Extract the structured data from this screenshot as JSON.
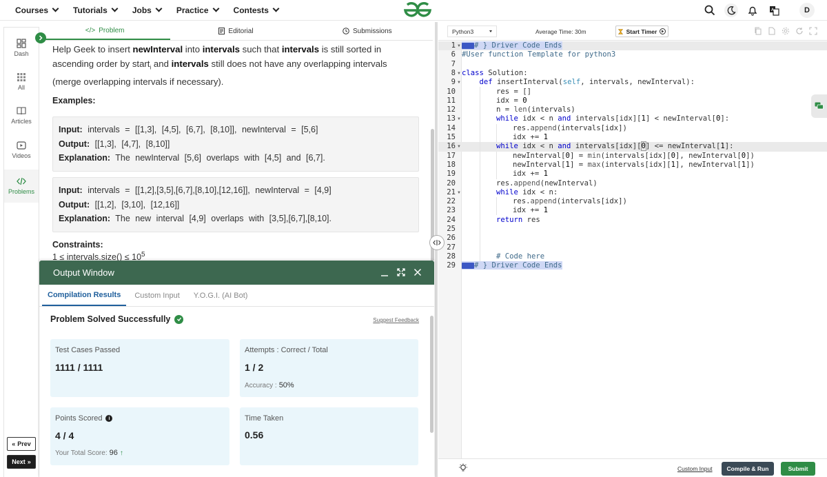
{
  "nav": {
    "items": [
      {
        "label": "Courses"
      },
      {
        "label": "Tutorials"
      },
      {
        "label": "Jobs"
      },
      {
        "label": "Practice"
      },
      {
        "label": "Contests"
      }
    ],
    "avatar": "D",
    "brand_color": "#2f8d46"
  },
  "rail": {
    "items": [
      {
        "label": "Dash",
        "icon": "dashboard-icon"
      },
      {
        "label": "All",
        "icon": "grid-icon"
      },
      {
        "label": "Articles",
        "icon": "book-icon"
      },
      {
        "label": "Videos",
        "icon": "video-icon"
      },
      {
        "label": "Problems",
        "icon": "code-icon"
      }
    ],
    "prev": "Prev",
    "next": "Next"
  },
  "problem_tabs": [
    {
      "label": "Problem",
      "icon": "</>"
    },
    {
      "label": "Editorial",
      "icon": "editorial-icon"
    },
    {
      "label": "Submissions",
      "icon": "clock-icon"
    }
  ],
  "statement": {
    "p1": "Help Geek to insert ",
    "b1": "newInterval",
    "p2": " into ",
    "b2": "intervals",
    "p3": " such that ",
    "b3": "intervals",
    "p4": " is still sorted in ascending order by start",
    "sub": "i",
    "p5": " and ",
    "b4": "intervals",
    "p6": " still does not have any overlapping intervals (merge overlapping intervals if necessary)."
  },
  "examples_heading": "Examples:",
  "examples": [
    {
      "input_label": "Input:",
      "input": "intervals = [[1,3], [4,5], [6,7], [8,10]], newInterval = [5,6]",
      "output_label": "Output:",
      "output": "[[1,3], [4,7], [8,10]]",
      "explanation_label": "Explanation:",
      "explanation": "The newInterval [5,6] overlaps with [4,5] and [6,7]."
    },
    {
      "input_label": "Input:",
      "input": "intervals = [[1,2],[3,5],[6,7],[8,10],[12,16]], newInterval = [4,9]",
      "output_label": "Output:",
      "output": "[[1,2], [3,10], [12,16]]",
      "explanation_label": "Explanation:",
      "explanation": "The new interval [4,9] overlaps with [3,5],[6,7],[8,10]."
    }
  ],
  "constraints": {
    "heading": "Constraints:",
    "line": "1 ≤ intervals.size() ≤ 10",
    "sup": "5"
  },
  "output_window": {
    "title": "Output Window",
    "tabs": [
      {
        "label": "Compilation Results"
      },
      {
        "label": "Custom Input"
      },
      {
        "label": "Y.O.G.I. (AI Bot)"
      }
    ],
    "status": "Problem Solved Successfully",
    "suggest": "Suggest Feedback",
    "cards": {
      "tests_title": "Test Cases Passed",
      "tests_value": "1111 / 1111",
      "attempts_title": "Attempts : Correct / Total",
      "attempts_value": "1 / 2",
      "accuracy_label": "Accuracy :",
      "accuracy_value": "50%",
      "points_title": "Points Scored",
      "points_value": "4 / 4",
      "total_label": "Your Total Score:",
      "total_value": "96",
      "time_title": "Time Taken",
      "time_value": "0.56"
    }
  },
  "editor": {
    "language": "Python3",
    "avg_time": "Average Time: 30m",
    "timer": "Start Timer",
    "custom_input": "Custom Input",
    "compile_run": "Compile & Run",
    "submit": "Submit",
    "lines": [
      {
        "n": "1",
        "fold": true
      },
      {
        "n": "6",
        "fold": false
      },
      {
        "n": "7",
        "fold": false
      },
      {
        "n": "8",
        "fold": true
      },
      {
        "n": "9",
        "fold": true
      },
      {
        "n": "10",
        "fold": false
      },
      {
        "n": "11",
        "fold": false
      },
      {
        "n": "12",
        "fold": false
      },
      {
        "n": "13",
        "fold": true
      },
      {
        "n": "14",
        "fold": false
      },
      {
        "n": "15",
        "fold": false
      },
      {
        "n": "16",
        "fold": true
      },
      {
        "n": "17",
        "fold": false
      },
      {
        "n": "18",
        "fold": false
      },
      {
        "n": "19",
        "fold": false
      },
      {
        "n": "20",
        "fold": false
      },
      {
        "n": "21",
        "fold": true
      },
      {
        "n": "22",
        "fold": false
      },
      {
        "n": "23",
        "fold": false
      },
      {
        "n": "24",
        "fold": false
      },
      {
        "n": "25",
        "fold": false
      },
      {
        "n": "26",
        "fold": false
      },
      {
        "n": "27",
        "fold": false
      },
      {
        "n": "28",
        "fold": false
      },
      {
        "n": "29",
        "fold": false
      }
    ],
    "code": {
      "l1": "# } Driver Code Ends",
      "l6": "#User function Template for python3",
      "l8a": "class",
      "l8b": " Solution:",
      "l9a": "def",
      "l9b": " insertInterval(",
      "l9c": "self",
      "l9d": ", intervals, newInterval):",
      "l10": "res = []",
      "l11a": "idx = ",
      "l11b": "0",
      "l12a": "n = ",
      "l12b": "len",
      "l12c": "(intervals)",
      "l13a": "while",
      "l13b": " idx < n ",
      "l13c": "and",
      "l13d": " intervals[idx][",
      "l13e": "1",
      "l13f": "] < newInterval[",
      "l13g": "0",
      "l13h": "]:",
      "l14a": "res.",
      "l14b": "append",
      "l14c": "(intervals[idx])",
      "l15a": "idx += ",
      "l15b": "1",
      "l16a": "while",
      "l16b": " idx < n ",
      "l16c": "and",
      "l16d": " intervals[idx][",
      "l16e": "0",
      "l16f": "] <= newInterval[",
      "l16g": "1",
      "l16h": "]:",
      "l17a": "newInterval[",
      "l17b": "0",
      "l17c": "] = ",
      "l17d": "min",
      "l17e": "(intervals[idx][",
      "l17f": "0",
      "l17g": "], newInterval[",
      "l17h": "0",
      "l17i": "])",
      "l18a": "newInterval[",
      "l18b": "1",
      "l18c": "] = ",
      "l18d": "max",
      "l18e": "(intervals[idx][",
      "l18f": "1",
      "l18g": "], newInterval[",
      "l18h": "1",
      "l18i": "])",
      "l19a": "idx += ",
      "l19b": "1",
      "l20a": "res.",
      "l20b": "append",
      "l20c": "(newInterval)",
      "l21a": "while",
      "l21b": " idx < n:",
      "l22a": "res.",
      "l22b": "append",
      "l22c": "(intervals[idx])",
      "l23a": "idx += ",
      "l23b": "1",
      "l24a": "return",
      "l24b": " res",
      "l28": "# Code here",
      "l29": "# } Driver Code Ends"
    }
  }
}
